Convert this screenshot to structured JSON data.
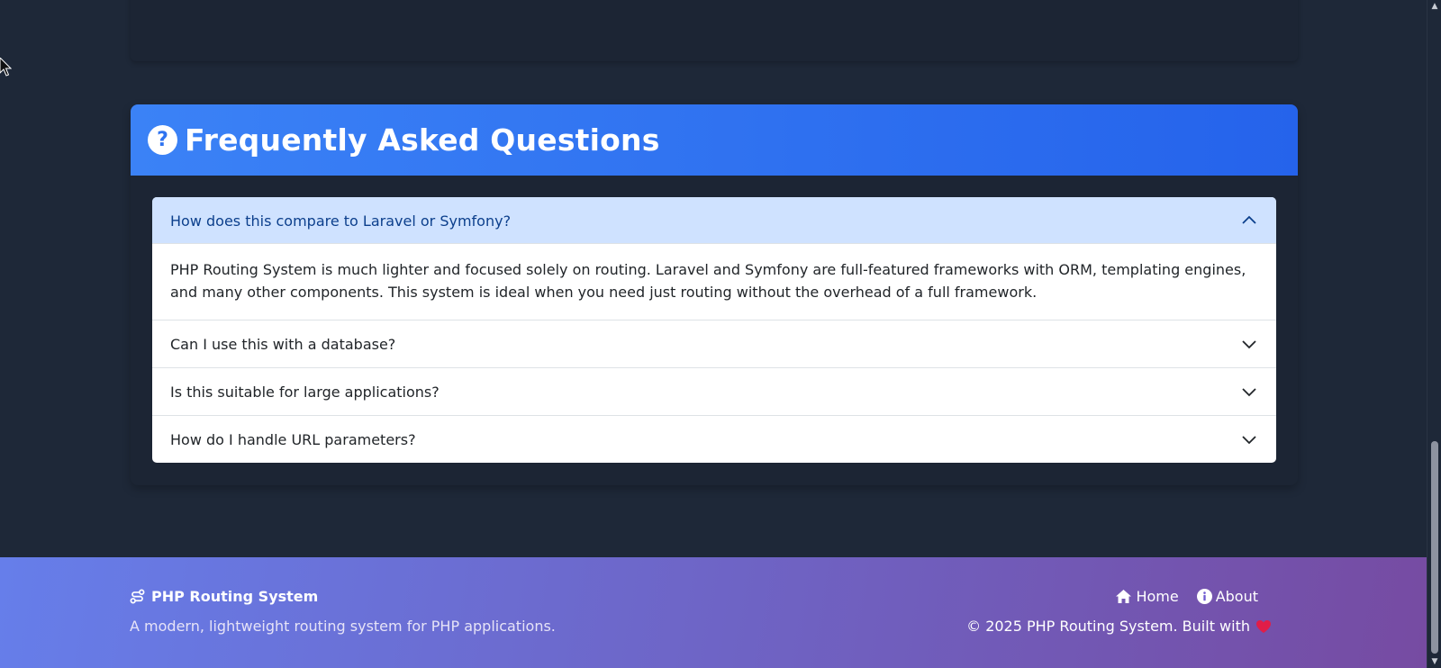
{
  "faq": {
    "title": "Frequently Asked Questions",
    "items": [
      {
        "question": "How does this compare to Laravel or Symfony?",
        "answer": "PHP Routing System is much lighter and focused solely on routing. Laravel and Symfony are full-featured frameworks with ORM, templating engines, and many other components. This system is ideal when you need just routing without the overhead of a full framework.",
        "expanded": true
      },
      {
        "question": "Can I use this with a database?",
        "expanded": false
      },
      {
        "question": "Is this suitable for large applications?",
        "expanded": false
      },
      {
        "question": "How do I handle URL parameters?",
        "expanded": false
      }
    ]
  },
  "footer": {
    "brand": "PHP Routing System",
    "tagline": "A modern, lightweight routing system for PHP applications.",
    "nav": [
      {
        "label": "Home",
        "icon": "home-icon"
      },
      {
        "label": "About",
        "icon": "info-icon"
      }
    ],
    "copyright": "© 2025 PHP Routing System. Built with",
    "heart_color": "#e11d48"
  },
  "colors": {
    "background": "#1e2838",
    "faq_header": "#3b82f6",
    "accordion_active_bg": "#cfe2ff",
    "footer_gradient_start": "#667eea",
    "footer_gradient_end": "#764ba2"
  }
}
